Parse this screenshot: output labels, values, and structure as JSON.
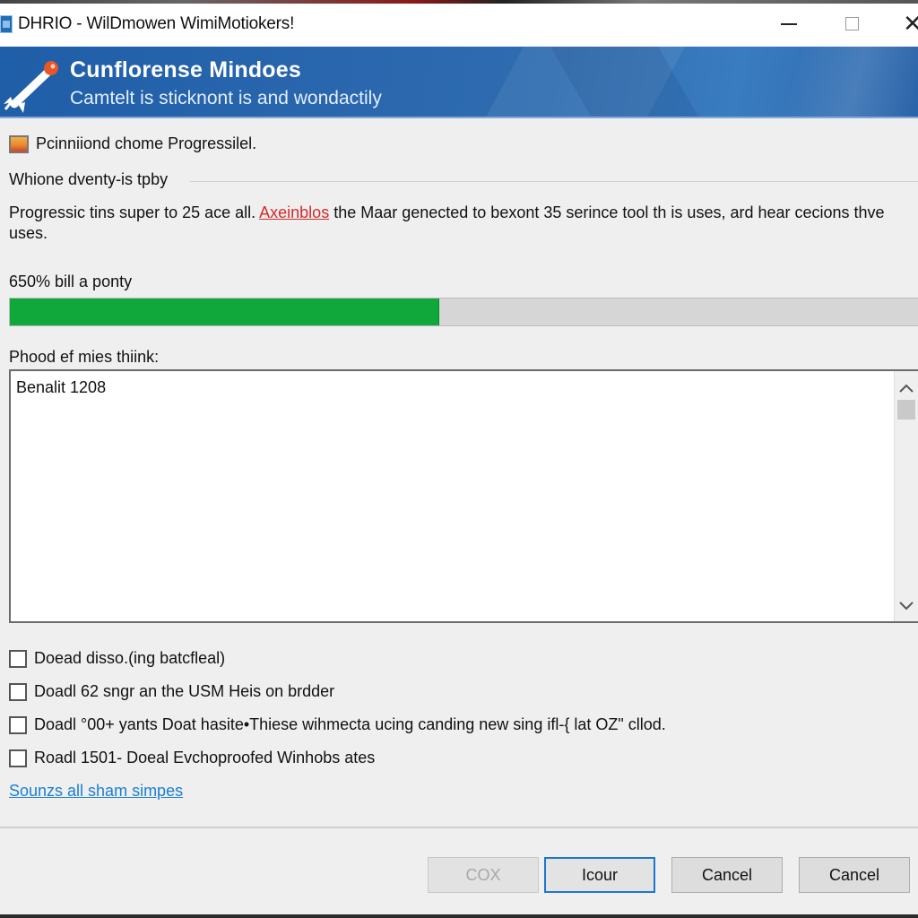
{
  "window": {
    "title": "DHRIO - WilDmowen WimiMotiokers!",
    "controls": {
      "minimize": "minimize",
      "maximize": "maximize",
      "close": "✕"
    }
  },
  "banner": {
    "title": "Cunflorense Mindoes",
    "subtitle": "Camtelt is sticknont is and wondactily",
    "logo_icon": "rocket-icon",
    "colors": {
      "background": "#2a67ae"
    }
  },
  "section": {
    "icon": "package-icon",
    "header": "Pcinniiond chome Progressilel."
  },
  "group": {
    "label": "Whione dventy-is tpby"
  },
  "description": {
    "text_before": "Progressic tins super to 25 ace all. ",
    "link_text": "Axeinblos",
    "text_after": " the Maar genected to bexont 35 serince tool th is uses, ard hear cecions thve uses.",
    "link_color": "#d42a2a"
  },
  "progress": {
    "label": "650% bill a ponty",
    "percent": 47,
    "fill_color": "#10a83a"
  },
  "output": {
    "label": "Phood ef mies thiink:",
    "content": "Benalit 1208"
  },
  "options": [
    {
      "label": "Doead disso.(ing batcfleal)",
      "checked": false
    },
    {
      "label": "Doadl 62 sngr an the USM Heis on brdder",
      "checked": false
    },
    {
      "label": "Doadl °00+ yants Doat hasite•Thiese wihmecta ucing canding new sing ifl-{ lat OZ\" cllod.",
      "checked": false
    },
    {
      "label": "Roadl 1501- Doeal Evchoproofed Winhobs ates",
      "checked": false
    }
  ],
  "link": {
    "label": "Sounzs all sham simpes",
    "color": "#1a7fd4"
  },
  "buttons": [
    {
      "label": "COX",
      "state": "disabled"
    },
    {
      "label": "Icour",
      "state": "default"
    },
    {
      "label": "Cancel",
      "state": "normal"
    },
    {
      "label": "Cancel",
      "state": "normal"
    }
  ]
}
